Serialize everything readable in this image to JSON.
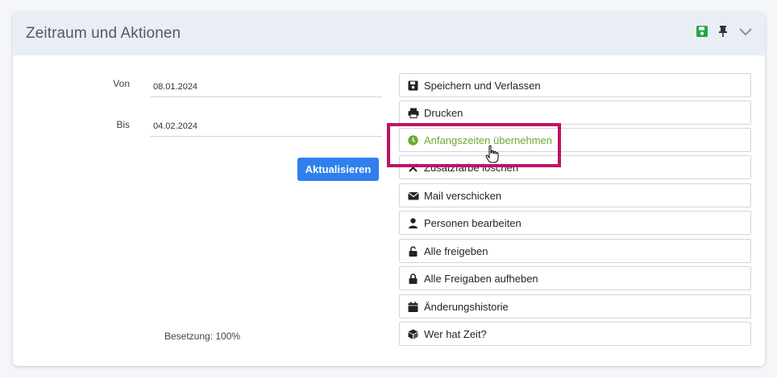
{
  "panel": {
    "title": "Zeitraum und Aktionen",
    "header_icons": [
      "save-icon",
      "pin-icon",
      "chevron-down-icon"
    ],
    "accent_save": "#22a745"
  },
  "form": {
    "from_label": "Von",
    "from_value": "08.01.2024",
    "to_label": "Bis",
    "to_value": "04.02.2024",
    "update_button": "Aktualisieren",
    "occupancy": "Besetzung: 100%"
  },
  "actions": [
    {
      "label": "Speichern und Verlassen",
      "icon": "save-icon"
    },
    {
      "label": "Drucken",
      "icon": "print-icon"
    },
    {
      "label": "Anfangszeiten übernehmen",
      "icon": "clock-icon",
      "active": true
    },
    {
      "label": "Zusatzfarbe löschen",
      "icon": "close-icon"
    },
    {
      "label": "Mail verschicken",
      "icon": "mail-icon"
    },
    {
      "label": "Personen bearbeiten",
      "icon": "person-icon"
    },
    {
      "label": "Alle freigeben",
      "icon": "unlock-icon"
    },
    {
      "label": "Alle Freigaben aufheben",
      "icon": "lock-icon"
    },
    {
      "label": "Änderungshistorie",
      "icon": "calendar-icon"
    },
    {
      "label": "Wer hat Zeit?",
      "icon": "cube-icon"
    }
  ],
  "colors": {
    "primary": "#2f80ed",
    "highlight_box": "#c0106a",
    "active_text": "#6aab32"
  }
}
